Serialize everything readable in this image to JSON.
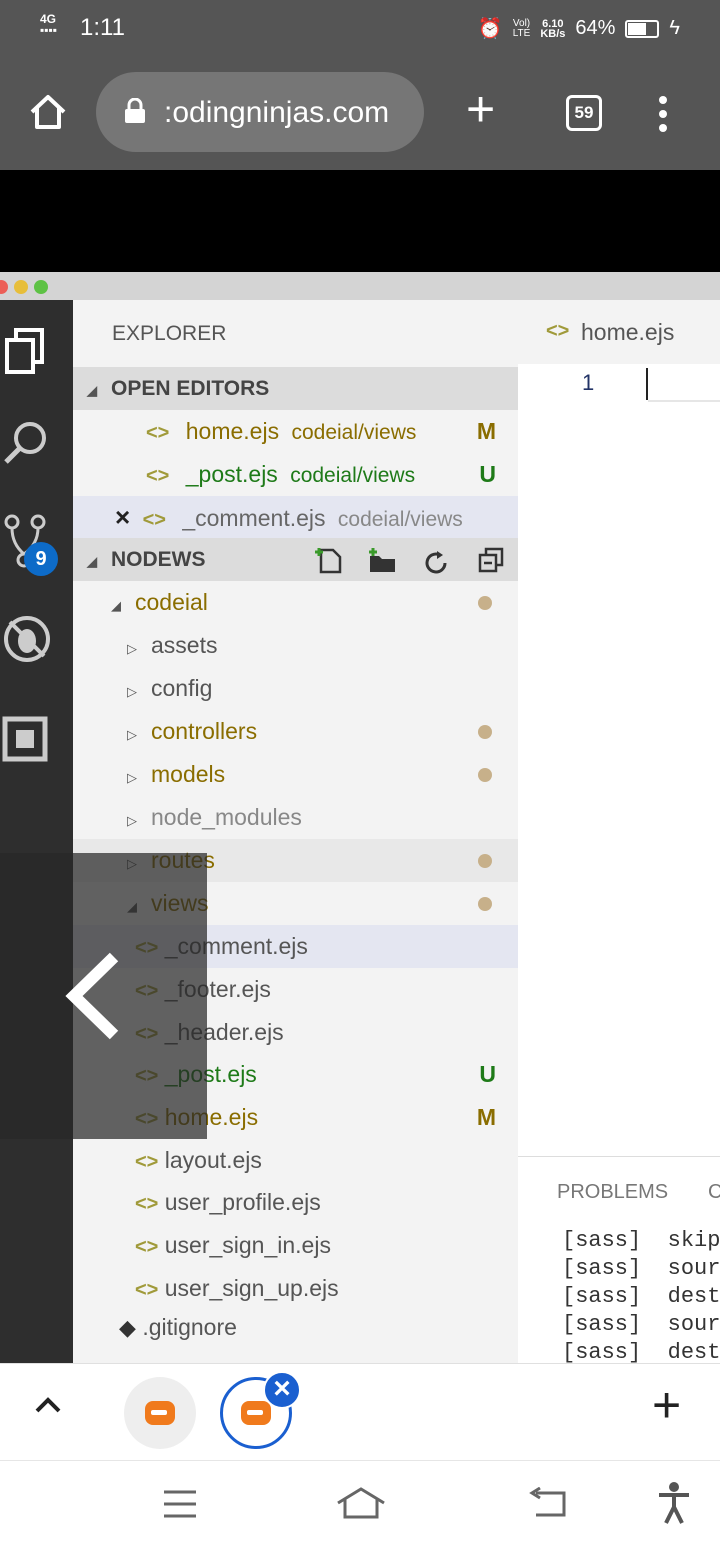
{
  "status": {
    "network": "4G",
    "time": "1:11",
    "lte": "LTE",
    "speed": "6.10",
    "speed_unit": "KB/s",
    "battery": "64%"
  },
  "browser": {
    "url": "codingninjas.com",
    "url_shown": ":odingninjas.com",
    "tab_count": "59"
  },
  "vscode": {
    "explorer_title": "EXPLORER",
    "open_editors_title": "OPEN EDITORS",
    "workspace_title": "NODEWS",
    "scm_badge": "9",
    "open_editors": [
      {
        "name": "home.ejs",
        "path": "codeial/views",
        "badge": "M"
      },
      {
        "name": "_post.ejs",
        "path": "codeial/views",
        "badge": "U"
      },
      {
        "name": "_comment.ejs",
        "path": "codeial/views",
        "close": "×"
      }
    ],
    "tree": {
      "root": "codeial",
      "folders": [
        "assets",
        "config",
        "controllers",
        "models",
        "node_modules",
        "routes"
      ],
      "views": "views",
      "view_files": [
        {
          "name": "_comment.ejs"
        },
        {
          "name": "_footer.ejs"
        },
        {
          "name": "_header.ejs"
        },
        {
          "name": "_post.ejs",
          "badge": "U"
        },
        {
          "name": "home.ejs",
          "badge": "M"
        },
        {
          "name": "layout.ejs"
        },
        {
          "name": "user_profile.ejs"
        },
        {
          "name": "user_sign_in.ejs"
        },
        {
          "name": "user_sign_up.ejs"
        }
      ],
      "gitignore": ".gitignore"
    },
    "editor_tab": "home.ejs",
    "line_number": "1",
    "panel_tab": "PROBLEMS",
    "panel_tab2": "C",
    "terminal": [
      {
        "tag": "[sass]",
        "text": "skip"
      },
      {
        "tag": "[sass]",
        "text": "sour"
      },
      {
        "tag": "[sass]",
        "text": "dest"
      },
      {
        "tag": "[sass]",
        "text": "sour"
      },
      {
        "tag": "[sass]",
        "text": "dest"
      }
    ]
  },
  "tab_close": "×",
  "tab_add": "+",
  "toolbar_add": "+",
  "icons": {
    "home": "home-icon",
    "lock": "lock-icon",
    "menu": "more-vert-icon"
  }
}
